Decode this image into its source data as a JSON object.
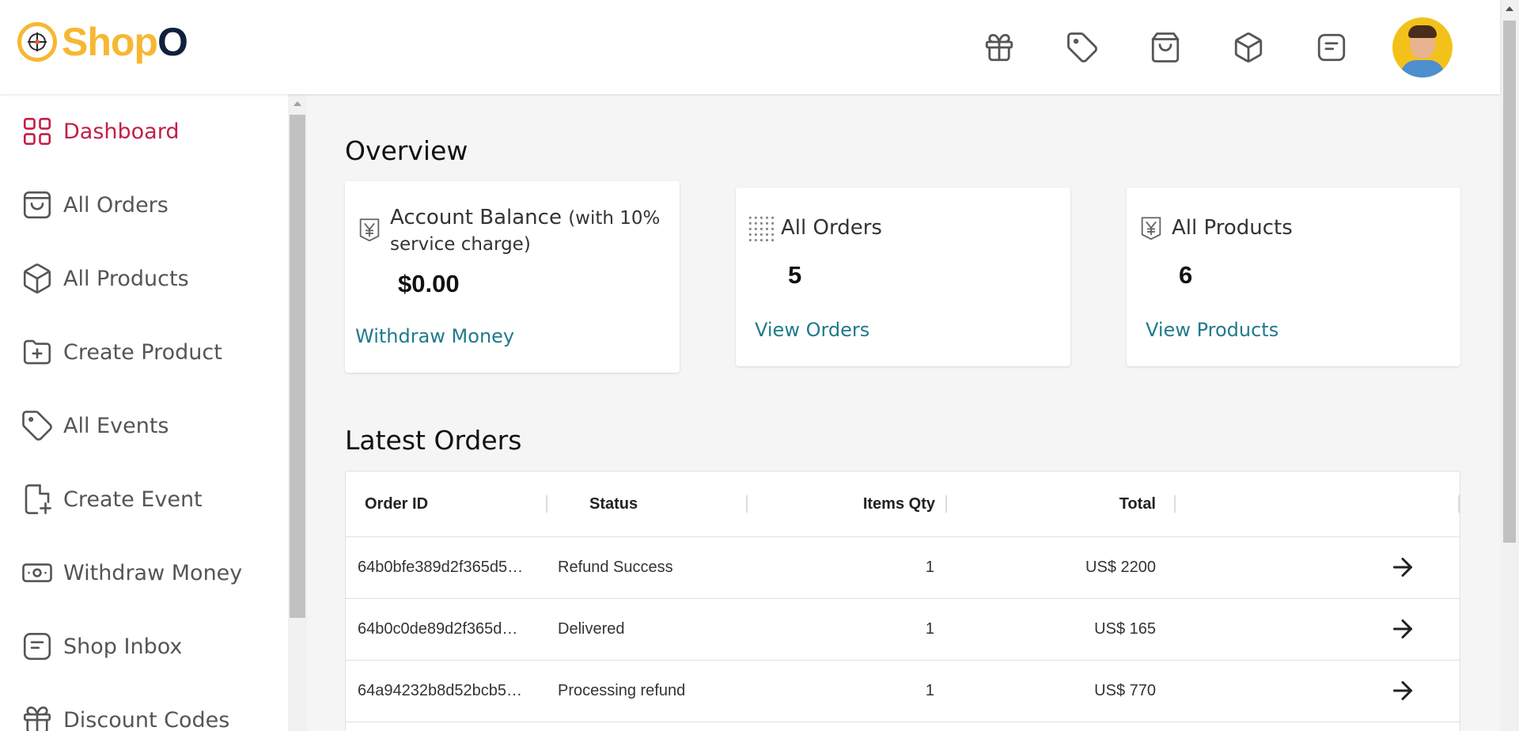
{
  "logo": {
    "part1": "Shop",
    "part2": "O"
  },
  "header_icons": [
    "gift-icon",
    "tag-icon",
    "shopping-bag-icon",
    "package-icon",
    "message-icon"
  ],
  "sidebar": {
    "items": [
      {
        "label": "Dashboard",
        "icon": "dashboard-grid-icon",
        "active": true
      },
      {
        "label": "All Orders",
        "icon": "shopping-bag-icon"
      },
      {
        "label": "All Products",
        "icon": "package-icon"
      },
      {
        "label": "Create Product",
        "icon": "folder-plus-icon"
      },
      {
        "label": "All Events",
        "icon": "tag-icon"
      },
      {
        "label": "Create Event",
        "icon": "file-plus-icon"
      },
      {
        "label": "Withdraw Money",
        "icon": "cash-icon"
      },
      {
        "label": "Shop Inbox",
        "icon": "message-icon"
      },
      {
        "label": "Discount Codes",
        "icon": "gift-icon"
      }
    ]
  },
  "overview": {
    "title": "Overview",
    "balance": {
      "title": "Account Balance",
      "subtitle": "(with 10%",
      "subtitle2": "service charge)",
      "value": "$0.00",
      "link": "Withdraw Money"
    },
    "orders": {
      "title": "All Orders",
      "value": "5",
      "link": "View Orders"
    },
    "products": {
      "title": "All Products",
      "value": "6",
      "link": "View Products"
    }
  },
  "latest": {
    "title": "Latest Orders",
    "columns": [
      "Order ID",
      "Status",
      "Items Qty",
      "Total"
    ],
    "rows": [
      {
        "id": "64b0bfe389d2f365d5…",
        "status": "Refund Success",
        "qty": "1",
        "total": "US$ 2200"
      },
      {
        "id": "64b0c0de89d2f365d…",
        "status": "Delivered",
        "qty": "1",
        "total": "US$ 165"
      },
      {
        "id": "64a94232b8d52bcb5…",
        "status": "Processing refund",
        "qty": "1",
        "total": "US$ 770"
      }
    ]
  },
  "colors": {
    "accent": "#c41e45",
    "link": "#1f7a8c",
    "logo_yellow": "#f7b733",
    "logo_navy": "#10203d"
  }
}
